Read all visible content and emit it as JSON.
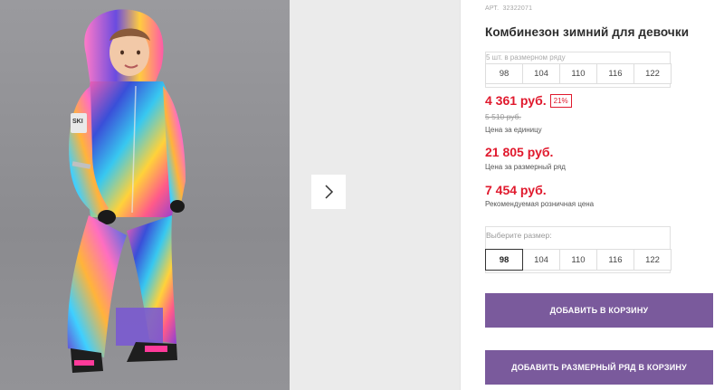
{
  "product": {
    "article_label": "АРТ.",
    "article_value": "32322071",
    "title": "Комбинезон зимний для девочки"
  },
  "size_range": {
    "caption": "5 шт. в размерном ряду",
    "sizes": [
      "98",
      "104",
      "110",
      "116",
      "122"
    ]
  },
  "prices": {
    "unit_price": "4 361 руб.",
    "discount": "21%",
    "old_price": "5 510 руб.",
    "unit_label": "Цена за единицу",
    "range_price": "21 805 руб.",
    "range_label": "Цена за размерный ряд",
    "rrp_price": "7 454 руб.",
    "rrp_label": "Рекомендуемая розничная цена"
  },
  "size_selector": {
    "caption": "Выберите размер:",
    "sizes": [
      "98",
      "104",
      "110",
      "116",
      "122"
    ],
    "selected": "98"
  },
  "buttons": {
    "add_to_cart": "ДОБАВИТЬ В КОРЗИНУ",
    "add_range_to_cart": "ДОБАВИТЬ РАЗМЕРНЫЙ РЯД В КОРЗИНУ"
  },
  "gallery": {
    "next_icon": "chevron-right-icon",
    "badge_text": "SKI"
  },
  "colors": {
    "price_red": "#e0192d",
    "button_purple": "#7a5a9c"
  }
}
